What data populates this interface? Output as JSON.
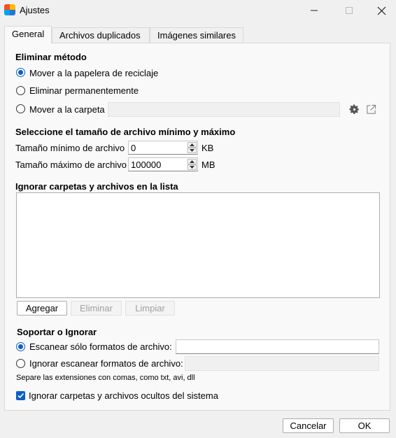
{
  "window": {
    "title": "Ajustes"
  },
  "tabs": [
    {
      "label": "General"
    },
    {
      "label": "Archivos duplicados"
    },
    {
      "label": "Imágenes similares"
    }
  ],
  "delete_method": {
    "heading": "Eliminar método",
    "options": [
      {
        "label": "Mover a la papelera de reciclaje",
        "selected": true
      },
      {
        "label": "Eliminar permanentemente",
        "selected": false
      },
      {
        "label": "Mover a la carpeta",
        "selected": false
      }
    ],
    "folder_value": ""
  },
  "size_limits": {
    "heading": "Seleccione el tamaño de archivo mínimo y máximo",
    "min_label": "Tamaño mínimo de archivo",
    "min_value": "0",
    "min_unit": "KB",
    "max_label": "Tamaño máximo de archivo",
    "max_value": "100000",
    "max_unit": "MB"
  },
  "ignore_list": {
    "heading": "Ignorar carpetas y archivos en la lista",
    "add_label": "Agregar",
    "remove_label": "Eliminar",
    "clear_label": "Limpiar"
  },
  "formats": {
    "heading": "Soportar o Ignorar",
    "scan_only_label": "Escanear sólo formatos de archivo:",
    "scan_only_selected": true,
    "scan_only_value": "",
    "ignore_label": "Ignorar escanear formatos de archivo:",
    "ignore_value": "",
    "note": "Separe las extensiones con comas, como txt, avi, dll"
  },
  "hidden_files": {
    "label": "Ignorar carpetas y archivos ocultos del sistema",
    "checked": true
  },
  "footer": {
    "cancel_label": "Cancelar",
    "ok_label": "OK"
  }
}
